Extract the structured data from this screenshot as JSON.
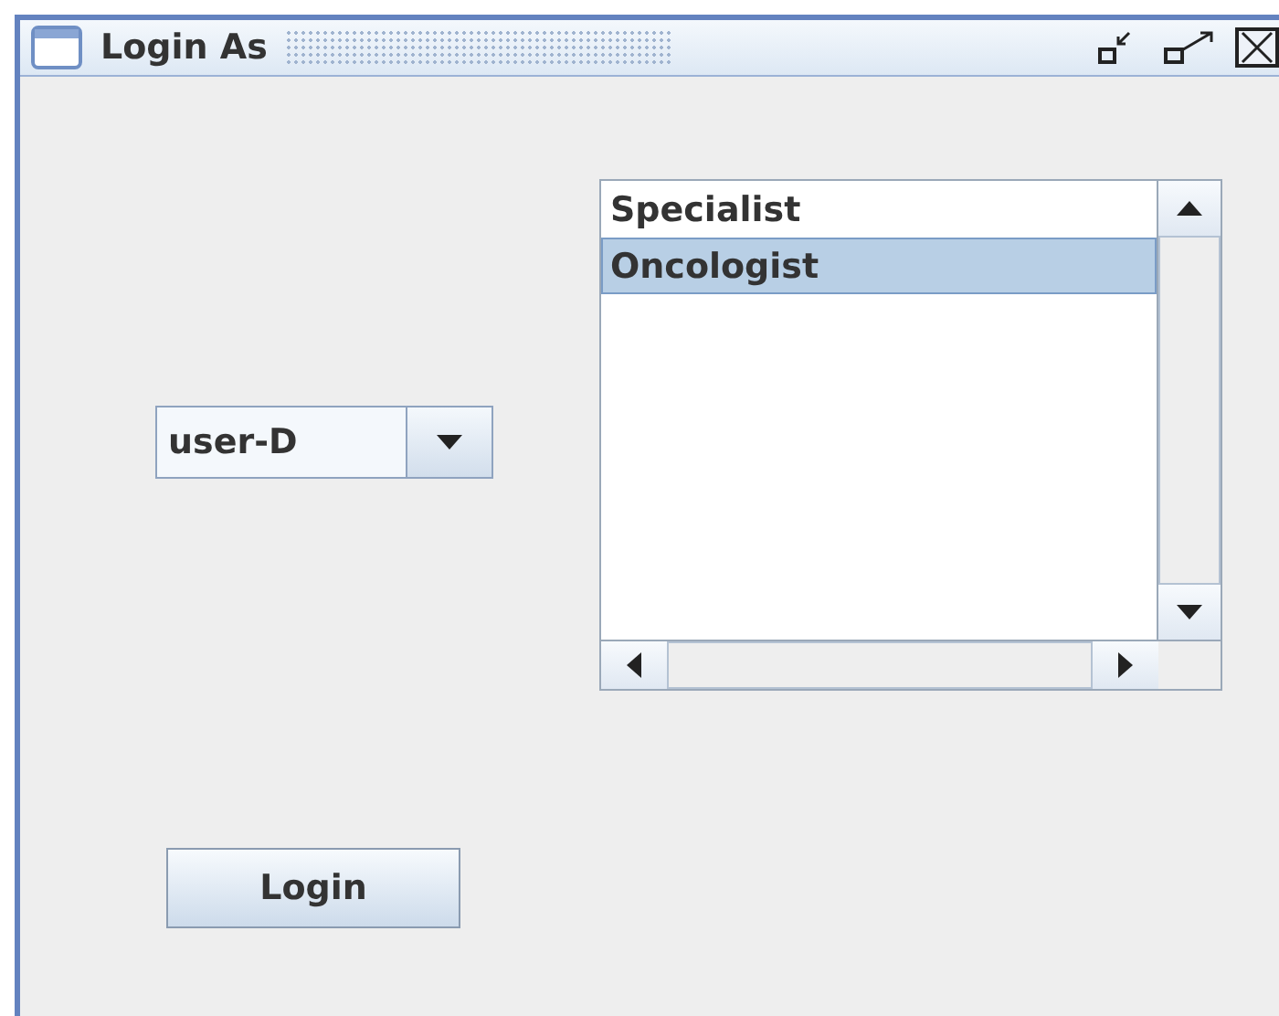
{
  "window": {
    "title": "Login As"
  },
  "user_combo": {
    "value": "user-D"
  },
  "role_list": {
    "items": [
      {
        "label": "Specialist",
        "selected": false
      },
      {
        "label": "Oncologist",
        "selected": true
      }
    ]
  },
  "login_button": {
    "label": "Login"
  }
}
